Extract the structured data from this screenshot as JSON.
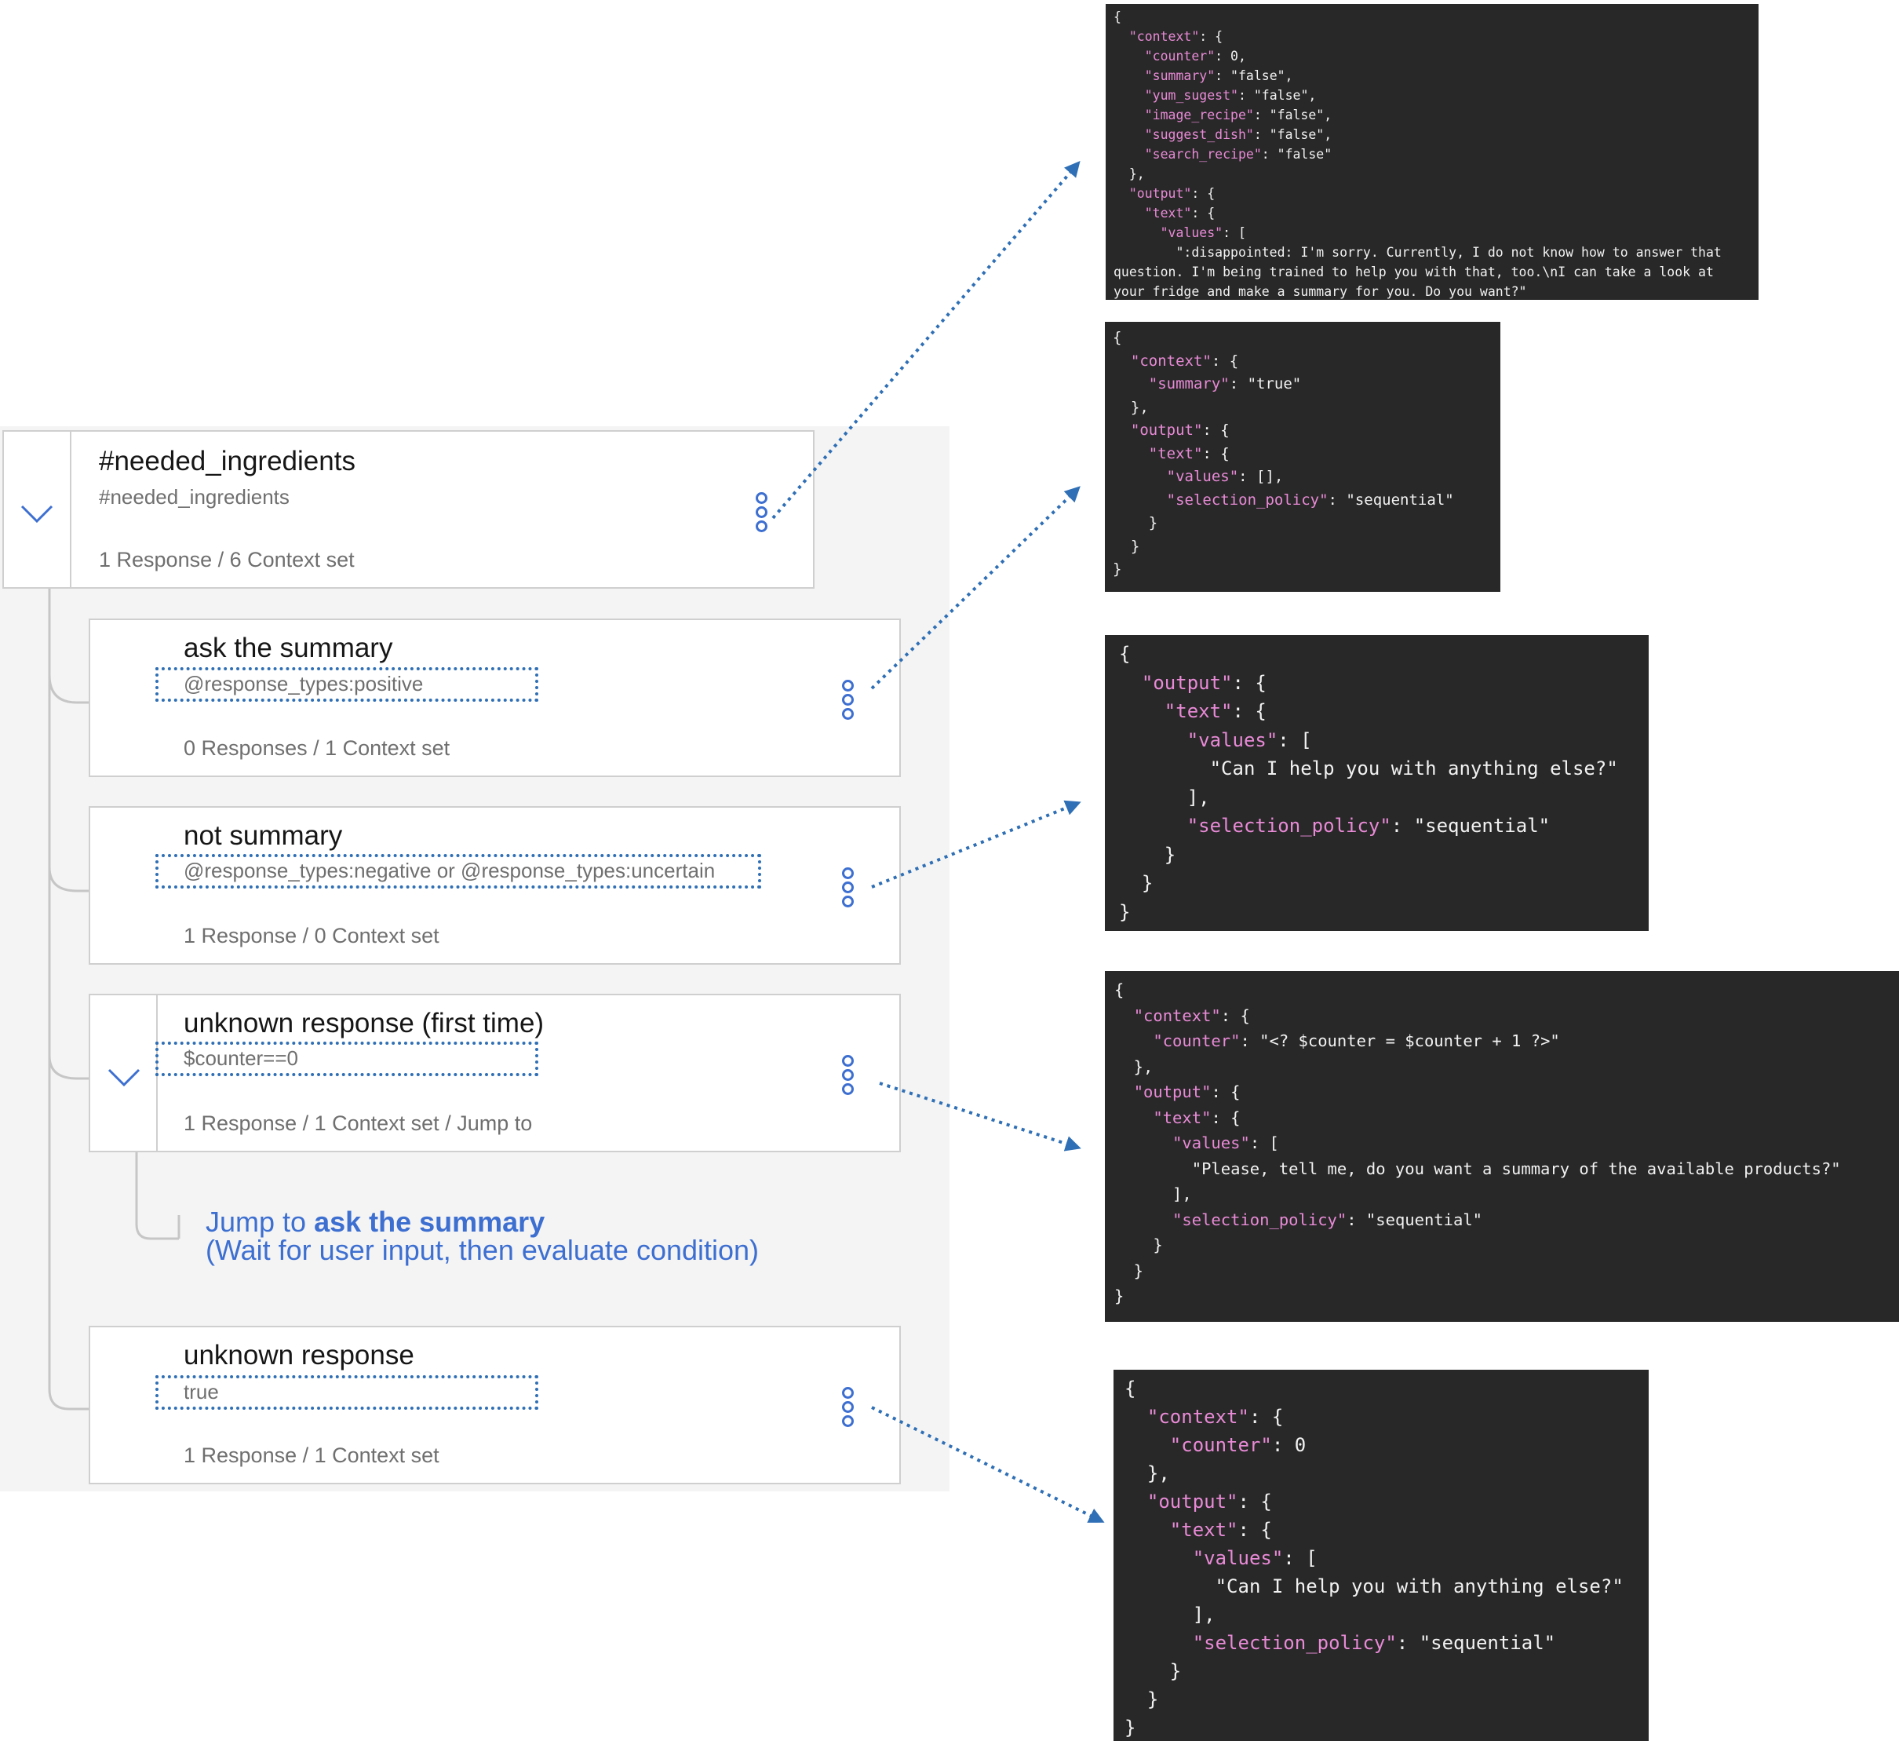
{
  "nodes": [
    {
      "id": "needed_ingredients",
      "title": "#needed_ingredients",
      "condition": "#needed_ingredients",
      "meta": "1 Response / 6 Context set",
      "expanded": true
    },
    {
      "id": "ask_the_summary",
      "title": "ask the summary",
      "condition": "@response_types:positive",
      "meta": "0 Responses / 1 Context set"
    },
    {
      "id": "not_summary",
      "title": "not summary",
      "condition": "@response_types:negative or @response_types:uncertain",
      "meta": "1 Response / 0 Context set"
    },
    {
      "id": "unknown_first",
      "title": "unknown response (first time)",
      "condition": "$counter==0",
      "meta": "1 Response / 1 Context set / Jump to",
      "expanded": true
    },
    {
      "id": "unknown",
      "title": "unknown response",
      "condition": "true",
      "meta": "1 Response / 1 Context set"
    }
  ],
  "jump": {
    "prefix": "Jump to ",
    "target": "ask the summary",
    "note": "(Wait for user input, then evaluate condition)"
  },
  "code_blocks": [
    "{\n  \"context\": {\n    \"counter\": 0,\n    \"summary\": \"false\",\n    \"yum_sugest\": \"false\",\n    \"image_recipe\": \"false\",\n    \"suggest_dish\": \"false\",\n    \"search_recipe\": \"false\"\n  },\n  \"output\": {\n    \"text\": {\n      \"values\": [\n        \":disappointed: I'm sorry. Currently, I do not know how to answer that\nquestion. I'm being trained to help you with that, too.\\nI can take a look at\nyour fridge and make a summary for you. Do you want?\"",
    "{\n  \"context\": {\n    \"summary\": \"true\"\n  },\n  \"output\": {\n    \"text\": {\n      \"values\": [],\n      \"selection_policy\": \"sequential\"\n    }\n  }\n}",
    "{\n  \"output\": {\n    \"text\": {\n      \"values\": [\n        \"Can I help you with anything else?\"\n      ],\n      \"selection_policy\": \"sequential\"\n    }\n  }\n}",
    "{\n  \"context\": {\n    \"counter\": \"<? $counter = $counter + 1 ?>\"\n  },\n  \"output\": {\n    \"text\": {\n      \"values\": [\n        \"Please, tell me, do you want a summary of the available products?\"\n      ],\n      \"selection_policy\": \"sequential\"\n    }\n  }\n}",
    "{\n  \"context\": {\n    \"counter\": 0\n  },\n  \"output\": {\n    \"text\": {\n      \"values\": [\n        \"Can I help you with anything else?\"\n      ],\n      \"selection_policy\": \"sequential\"\n    }\n  }\n}"
  ],
  "colors": {
    "accent": "#3d6fd1",
    "arrow": "#2f6fb5",
    "code_bg": "#282828",
    "code_key": "#e88ad6"
  }
}
